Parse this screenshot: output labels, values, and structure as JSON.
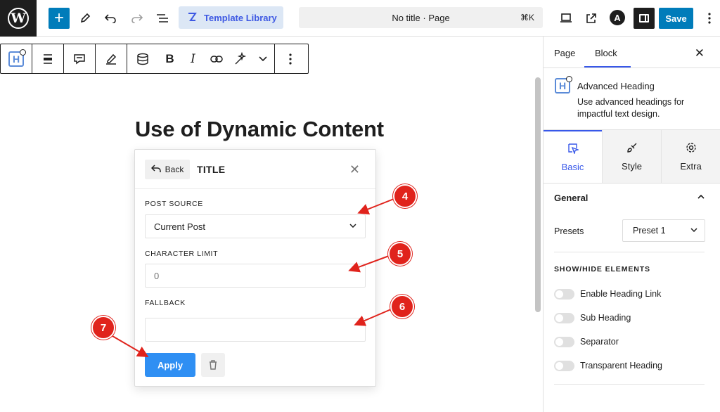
{
  "topbar": {
    "template_library": "Template Library",
    "doc_title": "No title · Page",
    "shortcut": "⌘K",
    "save": "Save"
  },
  "canvas": {
    "heading": "Use of Dynamic Content"
  },
  "popover": {
    "back": "Back",
    "title": "TITLE",
    "post_source_label": "POST SOURCE",
    "post_source_value": "Current Post",
    "char_limit_label": "CHARACTER LIMIT",
    "char_limit_value": "0",
    "fallback_label": "FALLBACK",
    "fallback_value": "",
    "apply": "Apply"
  },
  "annotations": [
    "4",
    "5",
    "6",
    "7"
  ],
  "sidebar": {
    "tab_page": "Page",
    "tab_block": "Block",
    "block_name": "Advanced Heading",
    "block_desc": "Use advanced headings for impactful text design.",
    "modes": [
      "Basic",
      "Style",
      "Extra"
    ],
    "section": "General",
    "presets_label": "Presets",
    "presets_value": "Preset 1",
    "show_hide": "SHOW/HIDE ELEMENTS",
    "toggles": [
      "Enable Heading Link",
      "Sub Heading",
      "Separator",
      "Transparent Heading"
    ]
  },
  "colors": {
    "wp_admin_blue": "#007cba",
    "accent": "#3858e9",
    "apply_blue": "#2f8ff3",
    "annotation_red": "#e0231c"
  }
}
